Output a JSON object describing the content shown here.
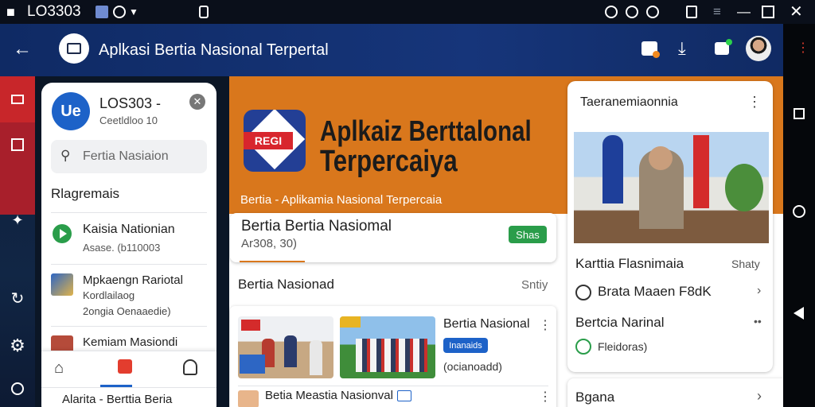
{
  "status_bar": {
    "carrier": "LO3303",
    "icons": [
      "lo-icon",
      "image-icon",
      "record-icon",
      "chevron-down-icon",
      "phone-icon",
      "alarm-icon",
      "wifi-icon",
      "clock-icon",
      "battery-icon",
      "menu-icon",
      "minimize-icon",
      "maximize-icon",
      "close-icon"
    ]
  },
  "app_bar": {
    "title": "Aplkasi Bertia Nasional Terpertal",
    "icons": [
      "back-arrow-icon",
      "app-logo-icon",
      "camera-icon",
      "download-icon",
      "message-icon",
      "avatar"
    ]
  },
  "drawer": {
    "account": {
      "initials": "Ue",
      "name": "LOS303 -",
      "subtitle": "Ceetldloo 10"
    },
    "search": {
      "placeholder": "Fertia Nasiaion"
    },
    "section_label": "Rlagremais",
    "items": [
      {
        "title": "Kaisia Nationian",
        "subtitle": "Asase. (b110003"
      },
      {
        "title": "Mpkaengn Rariotal",
        "subtitle": "Kordlailaog",
        "meta": "2ongia Oenaaedie)"
      },
      {
        "title": "Kemiam Masiondi"
      }
    ],
    "bottom_tabs": [
      "home-icon",
      "tag-icon",
      "person-icon"
    ],
    "footer": "Alarita - Berttia Beria"
  },
  "hero": {
    "logo_text": "REGI",
    "title_line1": "Aplkaiz Berttalonal",
    "title_line2": "Terpercaiya",
    "caption": "Bertia - Aplikamia Nasional Terpercaia"
  },
  "feature_card": {
    "title": "Bertia Bertia Nasiomal",
    "subtitle": "Ar308, 30)",
    "badge": "Shas"
  },
  "section": {
    "title": "Bertia Nasionad",
    "action": "Sntiy"
  },
  "news_card": {
    "title": "Bertia Nasional",
    "badge": "Inanaids",
    "meta": "(ocianoadd)",
    "footer_title": "Betia Meastia Nasionval"
  },
  "side_panel": {
    "header": "Taeranemiaonnia",
    "row1_title": "Karttia Flasnimaia",
    "row1_action": "Shaty",
    "row2_title": "Brata  Maaen F8dK",
    "row3_title": "Bertcia Narinal",
    "row3_sub": "Fleidoras)",
    "row4_title": "Bgana"
  },
  "colors": {
    "accent": "#e33d2e",
    "appbar": "#16357a",
    "orange": "#d9771c",
    "green": "#2a9d4a",
    "blue": "#1d62c8"
  }
}
